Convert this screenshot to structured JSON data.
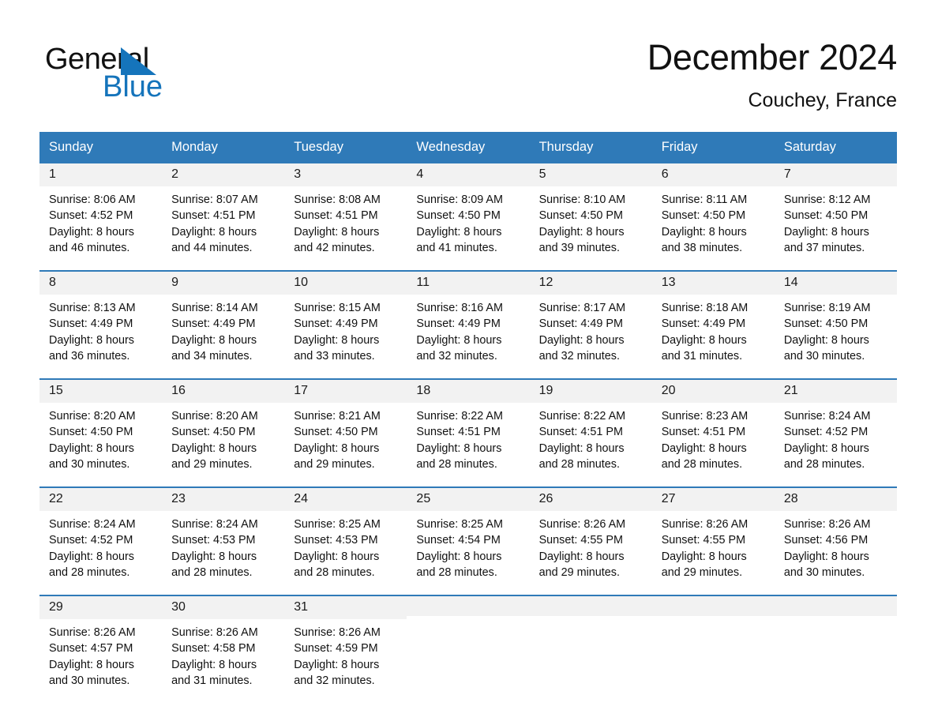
{
  "brand": {
    "name_part1": "General",
    "name_part2": "Blue",
    "triangle_color": "#1574bb",
    "logo_icon": "triangle-logo-icon"
  },
  "header": {
    "month_title": "December 2024",
    "location": "Couchey, France"
  },
  "theme": {
    "header_blue": "#2f7ab8",
    "daynum_band": "#f2f2f2",
    "brand_blue": "#1574bb"
  },
  "calendar": {
    "weekday_headers": [
      "Sunday",
      "Monday",
      "Tuesday",
      "Wednesday",
      "Thursday",
      "Friday",
      "Saturday"
    ],
    "weeks": [
      [
        {
          "day": "1",
          "sunrise": "Sunrise: 8:06 AM",
          "sunset": "Sunset: 4:52 PM",
          "daylight_line1": "Daylight: 8 hours",
          "daylight_line2": "and 46 minutes."
        },
        {
          "day": "2",
          "sunrise": "Sunrise: 8:07 AM",
          "sunset": "Sunset: 4:51 PM",
          "daylight_line1": "Daylight: 8 hours",
          "daylight_line2": "and 44 minutes."
        },
        {
          "day": "3",
          "sunrise": "Sunrise: 8:08 AM",
          "sunset": "Sunset: 4:51 PM",
          "daylight_line1": "Daylight: 8 hours",
          "daylight_line2": "and 42 minutes."
        },
        {
          "day": "4",
          "sunrise": "Sunrise: 8:09 AM",
          "sunset": "Sunset: 4:50 PM",
          "daylight_line1": "Daylight: 8 hours",
          "daylight_line2": "and 41 minutes."
        },
        {
          "day": "5",
          "sunrise": "Sunrise: 8:10 AM",
          "sunset": "Sunset: 4:50 PM",
          "daylight_line1": "Daylight: 8 hours",
          "daylight_line2": "and 39 minutes."
        },
        {
          "day": "6",
          "sunrise": "Sunrise: 8:11 AM",
          "sunset": "Sunset: 4:50 PM",
          "daylight_line1": "Daylight: 8 hours",
          "daylight_line2": "and 38 minutes."
        },
        {
          "day": "7",
          "sunrise": "Sunrise: 8:12 AM",
          "sunset": "Sunset: 4:50 PM",
          "daylight_line1": "Daylight: 8 hours",
          "daylight_line2": "and 37 minutes."
        }
      ],
      [
        {
          "day": "8",
          "sunrise": "Sunrise: 8:13 AM",
          "sunset": "Sunset: 4:49 PM",
          "daylight_line1": "Daylight: 8 hours",
          "daylight_line2": "and 36 minutes."
        },
        {
          "day": "9",
          "sunrise": "Sunrise: 8:14 AM",
          "sunset": "Sunset: 4:49 PM",
          "daylight_line1": "Daylight: 8 hours",
          "daylight_line2": "and 34 minutes."
        },
        {
          "day": "10",
          "sunrise": "Sunrise: 8:15 AM",
          "sunset": "Sunset: 4:49 PM",
          "daylight_line1": "Daylight: 8 hours",
          "daylight_line2": "and 33 minutes."
        },
        {
          "day": "11",
          "sunrise": "Sunrise: 8:16 AM",
          "sunset": "Sunset: 4:49 PM",
          "daylight_line1": "Daylight: 8 hours",
          "daylight_line2": "and 32 minutes."
        },
        {
          "day": "12",
          "sunrise": "Sunrise: 8:17 AM",
          "sunset": "Sunset: 4:49 PM",
          "daylight_line1": "Daylight: 8 hours",
          "daylight_line2": "and 32 minutes."
        },
        {
          "day": "13",
          "sunrise": "Sunrise: 8:18 AM",
          "sunset": "Sunset: 4:49 PM",
          "daylight_line1": "Daylight: 8 hours",
          "daylight_line2": "and 31 minutes."
        },
        {
          "day": "14",
          "sunrise": "Sunrise: 8:19 AM",
          "sunset": "Sunset: 4:50 PM",
          "daylight_line1": "Daylight: 8 hours",
          "daylight_line2": "and 30 minutes."
        }
      ],
      [
        {
          "day": "15",
          "sunrise": "Sunrise: 8:20 AM",
          "sunset": "Sunset: 4:50 PM",
          "daylight_line1": "Daylight: 8 hours",
          "daylight_line2": "and 30 minutes."
        },
        {
          "day": "16",
          "sunrise": "Sunrise: 8:20 AM",
          "sunset": "Sunset: 4:50 PM",
          "daylight_line1": "Daylight: 8 hours",
          "daylight_line2": "and 29 minutes."
        },
        {
          "day": "17",
          "sunrise": "Sunrise: 8:21 AM",
          "sunset": "Sunset: 4:50 PM",
          "daylight_line1": "Daylight: 8 hours",
          "daylight_line2": "and 29 minutes."
        },
        {
          "day": "18",
          "sunrise": "Sunrise: 8:22 AM",
          "sunset": "Sunset: 4:51 PM",
          "daylight_line1": "Daylight: 8 hours",
          "daylight_line2": "and 28 minutes."
        },
        {
          "day": "19",
          "sunrise": "Sunrise: 8:22 AM",
          "sunset": "Sunset: 4:51 PM",
          "daylight_line1": "Daylight: 8 hours",
          "daylight_line2": "and 28 minutes."
        },
        {
          "day": "20",
          "sunrise": "Sunrise: 8:23 AM",
          "sunset": "Sunset: 4:51 PM",
          "daylight_line1": "Daylight: 8 hours",
          "daylight_line2": "and 28 minutes."
        },
        {
          "day": "21",
          "sunrise": "Sunrise: 8:24 AM",
          "sunset": "Sunset: 4:52 PM",
          "daylight_line1": "Daylight: 8 hours",
          "daylight_line2": "and 28 minutes."
        }
      ],
      [
        {
          "day": "22",
          "sunrise": "Sunrise: 8:24 AM",
          "sunset": "Sunset: 4:52 PM",
          "daylight_line1": "Daylight: 8 hours",
          "daylight_line2": "and 28 minutes."
        },
        {
          "day": "23",
          "sunrise": "Sunrise: 8:24 AM",
          "sunset": "Sunset: 4:53 PM",
          "daylight_line1": "Daylight: 8 hours",
          "daylight_line2": "and 28 minutes."
        },
        {
          "day": "24",
          "sunrise": "Sunrise: 8:25 AM",
          "sunset": "Sunset: 4:53 PM",
          "daylight_line1": "Daylight: 8 hours",
          "daylight_line2": "and 28 minutes."
        },
        {
          "day": "25",
          "sunrise": "Sunrise: 8:25 AM",
          "sunset": "Sunset: 4:54 PM",
          "daylight_line1": "Daylight: 8 hours",
          "daylight_line2": "and 28 minutes."
        },
        {
          "day": "26",
          "sunrise": "Sunrise: 8:26 AM",
          "sunset": "Sunset: 4:55 PM",
          "daylight_line1": "Daylight: 8 hours",
          "daylight_line2": "and 29 minutes."
        },
        {
          "day": "27",
          "sunrise": "Sunrise: 8:26 AM",
          "sunset": "Sunset: 4:55 PM",
          "daylight_line1": "Daylight: 8 hours",
          "daylight_line2": "and 29 minutes."
        },
        {
          "day": "28",
          "sunrise": "Sunrise: 8:26 AM",
          "sunset": "Sunset: 4:56 PM",
          "daylight_line1": "Daylight: 8 hours",
          "daylight_line2": "and 30 minutes."
        }
      ],
      [
        {
          "day": "29",
          "sunrise": "Sunrise: 8:26 AM",
          "sunset": "Sunset: 4:57 PM",
          "daylight_line1": "Daylight: 8 hours",
          "daylight_line2": "and 30 minutes."
        },
        {
          "day": "30",
          "sunrise": "Sunrise: 8:26 AM",
          "sunset": "Sunset: 4:58 PM",
          "daylight_line1": "Daylight: 8 hours",
          "daylight_line2": "and 31 minutes."
        },
        {
          "day": "31",
          "sunrise": "Sunrise: 8:26 AM",
          "sunset": "Sunset: 4:59 PM",
          "daylight_line1": "Daylight: 8 hours",
          "daylight_line2": "and 32 minutes."
        },
        {
          "day": "",
          "sunrise": "",
          "sunset": "",
          "daylight_line1": "",
          "daylight_line2": ""
        },
        {
          "day": "",
          "sunrise": "",
          "sunset": "",
          "daylight_line1": "",
          "daylight_line2": ""
        },
        {
          "day": "",
          "sunrise": "",
          "sunset": "",
          "daylight_line1": "",
          "daylight_line2": ""
        },
        {
          "day": "",
          "sunrise": "",
          "sunset": "",
          "daylight_line1": "",
          "daylight_line2": ""
        }
      ]
    ]
  }
}
